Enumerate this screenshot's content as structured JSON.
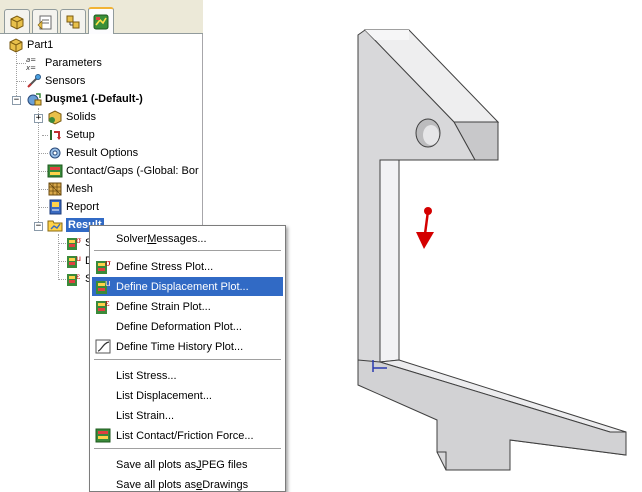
{
  "feature_tree": {
    "tabs": [
      {
        "icon": "feature-manager-icon"
      },
      {
        "icon": "property-manager-icon"
      },
      {
        "icon": "configuration-manager-icon"
      },
      {
        "icon": "simulation-manager-icon",
        "active": true
      }
    ],
    "items": {
      "part": "Part1",
      "parameters": "Parameters",
      "sensors": "Sensors",
      "study": "Duşme1 (-Default-)",
      "solids": "Solids",
      "setup": "Setup",
      "result_options": "Result Options",
      "contact_gaps": "Contact/Gaps (-Global: Bor",
      "mesh": "Mesh",
      "report": "Report",
      "results": "Result",
      "results_children": [
        "S",
        "D",
        "S"
      ]
    }
  },
  "context_menu": {
    "solver_messages": {
      "pre": "Solver ",
      "u": "M",
      "post": "essages..."
    },
    "define_stress": "Define Stress Plot...",
    "define_displacement": "Define Displacement Plot...",
    "define_strain": "Define Strain Plot...",
    "define_deformation": "Define Deformation Plot...",
    "define_time_history": "Define Time History Plot...",
    "list_stress": "List Stress...",
    "list_displacement": "List Displacement...",
    "list_strain": "List Strain...",
    "list_contact": "List Contact/Friction Force...",
    "save_jpeg": {
      "pre": "Save all plots as ",
      "u": "J",
      "post": "PEG files"
    },
    "save_edrawings": {
      "pre": "Save all plots as ",
      "u": "e",
      "post": "Drawings"
    },
    "highlighted_item": "Define Displacement Plot..."
  },
  "colors": {
    "selection": "#316ac5",
    "part_face": "#d8d8da",
    "part_top": "#eeeeef",
    "load_arrow": "#d40000"
  }
}
